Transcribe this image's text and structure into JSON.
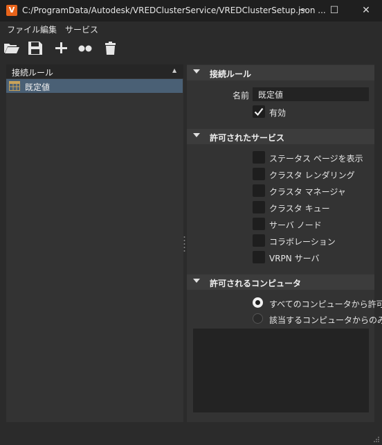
{
  "window": {
    "title": "C:/ProgramData/Autodesk/VREDClusterService/VREDClusterSetup.json ...",
    "app_icon_letter": "V",
    "minimize": "─",
    "maximize": "☐",
    "close": "✕"
  },
  "menu": [
    "ファイル",
    "編集",
    "サービス"
  ],
  "toolbar": [
    "open-folder-icon",
    "save-icon",
    "add-icon",
    "clone-icon",
    "delete-icon"
  ],
  "left": {
    "header": "接続ルール",
    "rules": [
      "既定値"
    ]
  },
  "connection_rule": {
    "title": "接続ルール",
    "name_label": "名前",
    "name_value": "既定値",
    "enabled_label": "有効",
    "enabled": true
  },
  "services": {
    "title": "許可されたサービス",
    "items": [
      "ステータス ページを表示",
      "クラスタ レンダリング",
      "クラスタ マネージャ",
      "クラスタ キュー",
      "サーバ ノード",
      "コラボレーション",
      "VRPN サーバ"
    ]
  },
  "computers": {
    "title": "許可されるコンピュータ",
    "options": [
      "すべてのコンピュータから許可",
      "該当するコンピュータからのみ"
    ],
    "selected": 0
  },
  "colors": {
    "accent": "#e8641b",
    "selection": "#4a6075"
  }
}
